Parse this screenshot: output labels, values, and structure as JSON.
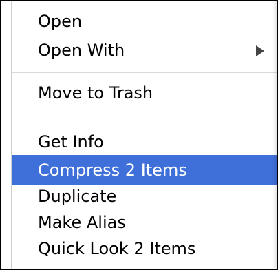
{
  "context_menu": {
    "items": [
      {
        "label": "Open"
      },
      {
        "label": "Open With"
      },
      {
        "label": "Move to Trash"
      },
      {
        "label": "Get Info"
      },
      {
        "label": "Compress 2 Items"
      },
      {
        "label": "Duplicate"
      },
      {
        "label": "Make Alias"
      },
      {
        "label": "Quick Look 2 Items"
      }
    ]
  }
}
